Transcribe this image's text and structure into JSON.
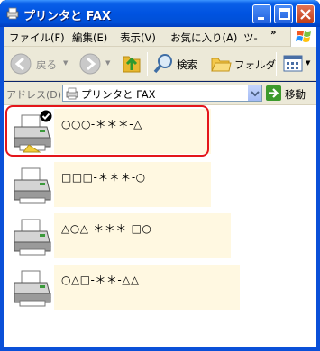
{
  "window": {
    "title": "プリンタと FAX"
  },
  "menu": {
    "file": "ファイル(F)",
    "edit": "編集(E)",
    "view": "表示(V)",
    "favorites": "お気に入り(A)",
    "tools": "ツ-",
    "more": "»"
  },
  "toolbar": {
    "back": "戻る",
    "search": "検索",
    "folders": "フォルダ"
  },
  "address": {
    "label": "アドレス(D)",
    "value": "プリンタと FAX",
    "go": "移動"
  },
  "printers": [
    {
      "name": "○○○-＊＊＊-△",
      "default": true,
      "selected": true
    },
    {
      "name": "□□□-＊＊＊-○",
      "default": false,
      "selected": false
    },
    {
      "name": "△○△-＊＊＊-□○",
      "default": false,
      "selected": false
    },
    {
      "name": "○△□-＊＊-△△",
      "default": false,
      "selected": false
    }
  ],
  "colors": {
    "titlebar": "#0053e1",
    "selection_outline": "#e4161b",
    "label_background": "#fff8e1"
  }
}
